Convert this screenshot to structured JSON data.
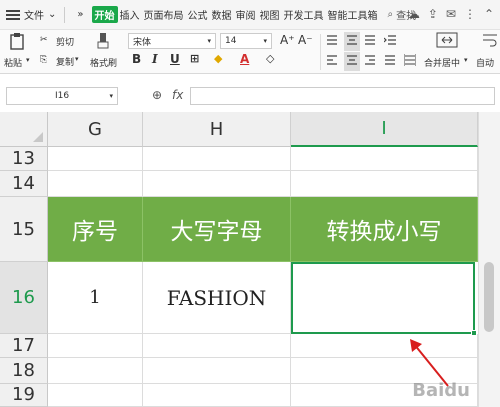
{
  "menubar": {
    "file": "文件",
    "more": "»",
    "tabs": [
      "开始",
      "插入",
      "页面布局",
      "公式",
      "数据",
      "审阅",
      "视图",
      "开发工具",
      "智能工具箱"
    ],
    "search": "查找"
  },
  "ribbon": {
    "paste": "粘贴",
    "cut": "剪切",
    "copy": "复制",
    "format_painter": "格式刷",
    "font_name": "宋体",
    "font_size": "14",
    "merge_center": "合并居中",
    "wrap": "自动"
  },
  "formula_bar": {
    "cell_ref": "I16",
    "fx": "fx",
    "content": ""
  },
  "sheet": {
    "columns": [
      "G",
      "H",
      "I"
    ],
    "rows": [
      "13",
      "14",
      "15",
      "16",
      "17",
      "18",
      "19"
    ],
    "header_row": [
      "序号",
      "大写字母",
      "转换成小写"
    ],
    "data_row": [
      "1",
      "FASHION",
      ""
    ],
    "selected_column": "I",
    "selected_row": "16",
    "header_fill": "#70ad47",
    "selection_color": "#1e9a4d"
  },
  "watermark": "Baidu"
}
